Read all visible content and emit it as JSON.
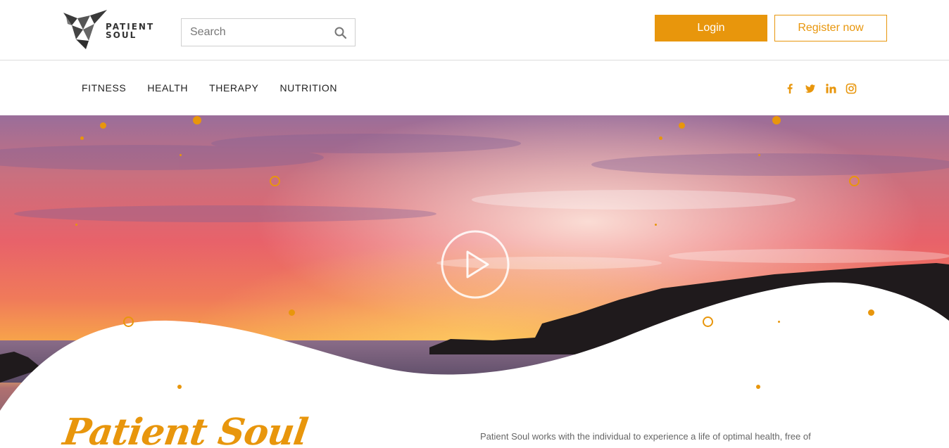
{
  "header": {
    "logo": {
      "line1": "PATIENT",
      "line2": "SOUL"
    },
    "search": {
      "placeholder": "Search",
      "value": "",
      "icon": "search-icon"
    },
    "login_label": "Login",
    "register_label": "Register now"
  },
  "nav": {
    "items": [
      {
        "label": "FITNESS"
      },
      {
        "label": "HEALTH"
      },
      {
        "label": "THERAPY"
      },
      {
        "label": "NUTRITION"
      }
    ],
    "social": [
      "facebook-icon",
      "twitter-icon",
      "linkedin-icon",
      "instagram-icon"
    ]
  },
  "hero": {
    "media": "sunset-over-coastline",
    "play_icon": "play-icon"
  },
  "main": {
    "title": "Patient Soul",
    "intro": "Patient Soul works with the individual to experience a life of optimal health, free of"
  },
  "colors": {
    "accent": "#e8960c",
    "text": "#222222",
    "muted": "#666666"
  }
}
